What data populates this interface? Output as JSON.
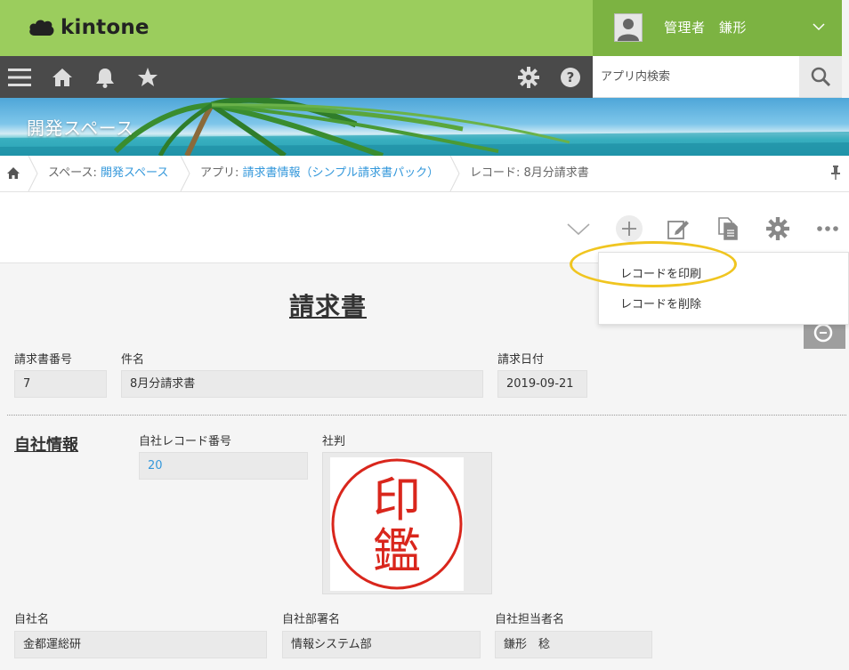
{
  "header": {
    "logo_text": "kintone",
    "user_name": "管理者　鎌形"
  },
  "toolbar": {
    "search_placeholder": "アプリ内検索"
  },
  "banner": {
    "space_title": "開発スペース"
  },
  "breadcrumb": {
    "space_prefix": "スペース: ",
    "space_link": "開発スペース",
    "app_prefix": "アプリ: ",
    "app_link": "請求書情報（シンプル請求書パック）",
    "record_text": "レコード: 8月分請求書"
  },
  "menu": {
    "items": [
      {
        "label": "レコードを印刷"
      },
      {
        "label": "レコードを削除"
      }
    ]
  },
  "form": {
    "title": "請求書",
    "invoice_number": {
      "label": "請求書番号",
      "value": "7"
    },
    "subject": {
      "label": "件名",
      "value": "8月分請求書"
    },
    "invoice_date": {
      "label": "請求日付",
      "value": "2019-09-21"
    },
    "section_title": "自社情報",
    "company_record_number": {
      "label": "自社レコード番号",
      "value": "20"
    },
    "company_seal": {
      "label": "社判",
      "seal_text_1": "印",
      "seal_text_2": "鑑"
    },
    "company_name": {
      "label": "自社名",
      "value": "金都運総研"
    },
    "department": {
      "label": "自社部署名",
      "value": "情報システム部"
    },
    "staff": {
      "label": "自社担当者名",
      "value": "鎌形　稔"
    }
  },
  "colors": {
    "header_green": "#9bcd5d",
    "user_green": "#7cb342",
    "toolbar_dark": "#4a4a4a",
    "link_blue": "#3498db",
    "highlight_yellow": "#f0c520",
    "seal_red": "#d9261c"
  },
  "icons": {
    "menu": "hamburger-icon",
    "home": "home-icon",
    "notifications": "bell-icon",
    "favorites": "star-icon",
    "settings": "gear-icon",
    "help": "question-icon",
    "search": "search-icon"
  }
}
